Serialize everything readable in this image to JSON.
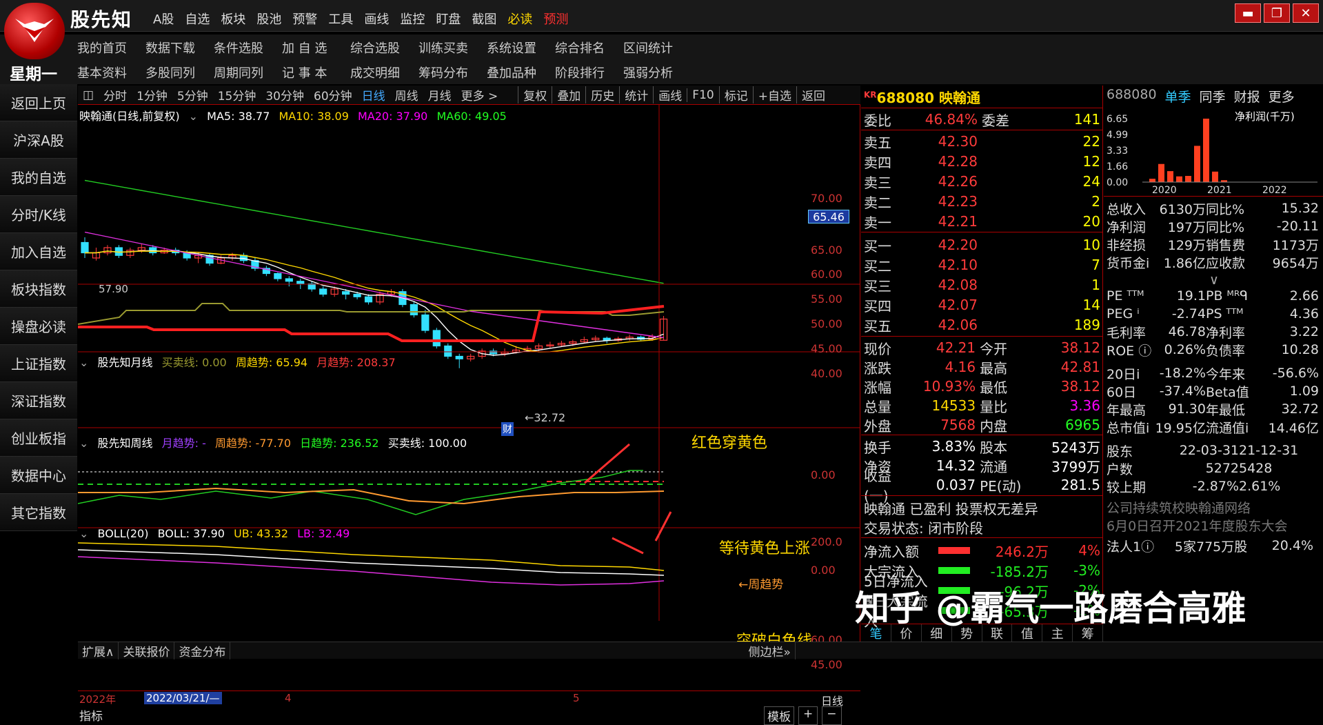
{
  "app": {
    "name": "股先知",
    "menu": [
      "A股",
      "自选",
      "板块",
      "股池",
      "预警",
      "工具",
      "画线",
      "监控",
      "盯盘",
      "截图",
      "必读",
      "预测"
    ],
    "window_buttons": [
      "▬",
      "❐",
      "✕"
    ]
  },
  "row2": [
    "我的首页",
    "数据下载",
    "条件选股",
    "加 自 选",
    "综合选股",
    "训练买卖",
    "系统设置",
    "综合排名",
    "区间统计"
  ],
  "row3": [
    "基本资料",
    "多股同列",
    "周期同列",
    "记 事 本",
    "成交明细",
    "筹码分布",
    "叠加品种",
    "阶段排行",
    "强弱分析"
  ],
  "weekday": "星期一",
  "sidebar": [
    "返回上页",
    "沪深A股",
    "我的自选",
    "分时/K线",
    "加入自选",
    "板块指数",
    "操盘必读",
    "上证指数",
    "深证指数",
    "创业板指",
    "数据中心",
    "其它指数"
  ],
  "toolbar": {
    "periods": [
      "分时",
      "1分钟",
      "5分钟",
      "15分钟",
      "30分钟",
      "60分钟",
      "日线",
      "周线",
      "月线",
      "更多 >"
    ],
    "buttons": [
      "复权",
      "叠加",
      "历史",
      "统计",
      "画线",
      "F10",
      "标记",
      "+自选",
      "返回"
    ]
  },
  "chart1": {
    "title": "映翰通(日线,前复权)",
    "ma5": "MA5: 38.77",
    "ma10": "MA10: 38.09",
    "ma20": "MA20: 37.90",
    "ma60": "MA60: 49.05",
    "price_ticks": [
      "70.00",
      "65.00",
      "60.00",
      "55.00",
      "50.00",
      "45.00",
      "40.00"
    ],
    "cursor_price": "65.46",
    "high_label": "57.90",
    "low_label": "←32.72",
    "cai_marker": "财"
  },
  "chart2": {
    "title": "股先知月线",
    "l1": "买卖线: 0.00",
    "l2": "周趋势: 65.94",
    "l3": "月趋势: 208.37",
    "tick": "0.00",
    "annot": "红色穿黄色"
  },
  "chart3": {
    "title": "股先知周线",
    "l1": "月趋势: -",
    "l2": "周趋势: -77.70",
    "l3": "日趋势: 236.52",
    "l4": "买卖线: 100.00",
    "ticks": [
      "200.0",
      "0.00"
    ],
    "annot": "等待黄色上涨",
    "zq": "←周趋势"
  },
  "chart4": {
    "title": "BOLL(20)",
    "l1": "BOLL: 37.90",
    "l2": "UB: 43.32",
    "l3": "LB: 32.49",
    "ticks": [
      "60.00",
      "45.00"
    ],
    "annot": "突破白色线"
  },
  "xaxis": {
    "year": "2022年",
    "date": "2022/03/21/—",
    "m4": "4",
    "m5": "5",
    "period": "日线"
  },
  "bottom_left": {
    "indicator": "指标",
    "items": [
      "扩展∧",
      "关联报价",
      "资金分布"
    ],
    "mb": "模板",
    "plus": "+",
    "minus": "−",
    "sidebar": "侧边栏»"
  },
  "quote": {
    "code": "688080",
    "name": "映翰通",
    "kr": "KR",
    "weibi": {
      "l": "委比",
      "v": "46.84%",
      "l2": "委差",
      "n": "141"
    },
    "sells": [
      [
        "卖五",
        "42.30",
        "22"
      ],
      [
        "卖四",
        "42.28",
        "12"
      ],
      [
        "卖三",
        "42.26",
        "24"
      ],
      [
        "卖二",
        "42.23",
        "2"
      ],
      [
        "卖一",
        "42.21",
        "20"
      ]
    ],
    "buys": [
      [
        "买一",
        "42.20",
        "10"
      ],
      [
        "买二",
        "42.10",
        "7"
      ],
      [
        "买三",
        "42.08",
        "1"
      ],
      [
        "买四",
        "42.07",
        "14"
      ],
      [
        "买五",
        "42.06",
        "189"
      ]
    ],
    "stats": [
      [
        "现价",
        "42.21",
        "今开",
        "38.12"
      ],
      [
        "涨跌",
        "4.16",
        "最高",
        "42.81"
      ],
      [
        "涨幅",
        "10.93%",
        "最低",
        "38.12"
      ],
      [
        "总量",
        "14533",
        "量比",
        "3.36"
      ],
      [
        "外盘",
        "7568",
        "内盘",
        "6965"
      ]
    ],
    "stats2": [
      [
        "换手",
        "3.83%",
        "股本",
        "5243万"
      ],
      [
        "净资",
        "14.32",
        "流通",
        "3799万"
      ],
      [
        "收益(一)",
        "0.037",
        "PE(动)",
        "281.5"
      ]
    ],
    "profit": "映翰通 已盈利 投票权无差异",
    "status": "交易状态: 闭市阶段",
    "flows": [
      [
        "净流入额",
        "246.2万",
        "4%"
      ],
      [
        "大宗流入",
        "-185.2万",
        "-3%"
      ],
      [
        "5日净流入额",
        "-96.2万",
        "-2%"
      ],
      [
        "5日大宗流入",
        "-65.3万",
        "-1%"
      ]
    ],
    "tabs": [
      "笔",
      "价",
      "细",
      "势",
      "联",
      "值",
      "主",
      "筹"
    ]
  },
  "fin": {
    "code": "688080",
    "tabs": [
      "单季",
      "同季",
      "财报",
      "更多"
    ],
    "chart_title": "净利润(千万)",
    "yticks": [
      "6.65",
      "4.99",
      "3.33",
      "1.66",
      "0.00"
    ],
    "xticks": [
      "2020",
      "2021",
      "2022"
    ],
    "rows": [
      [
        "总收入",
        "6130万",
        "同比%",
        "15.32"
      ],
      [
        "净利润",
        "197万",
        "同比%",
        "-20.11"
      ],
      [
        "非经损",
        "129万",
        "销售费",
        "1173万"
      ],
      [
        "货币金i",
        "1.86亿",
        "应收款",
        "9654万"
      ]
    ],
    "rows2": [
      [
        "PE ᵀᵀᴹ",
        "19.1",
        "PB ᴹᴿᑫ",
        "2.66"
      ],
      [
        "PEG ⁱ",
        "-2.74",
        "PS ᵀᵀᴹ",
        "4.36"
      ],
      [
        "毛利率",
        "46.78",
        "净利率",
        "3.22"
      ],
      [
        "ROE ⓘ",
        "0.26%",
        "负债率",
        "10.28"
      ]
    ],
    "rows3": [
      [
        "20日i",
        "-18.2%",
        "今年来",
        "-56.6%"
      ],
      [
        "60日",
        "-37.4%",
        "Beta值",
        "1.09"
      ],
      [
        "年最高",
        "91.30",
        "年最低",
        "32.72"
      ],
      [
        "总市值i",
        "19.95亿",
        "流通值i",
        "14.46亿"
      ]
    ],
    "rows4": [
      [
        "股东",
        "22-03-31",
        "21-12-31"
      ],
      [
        "户数",
        "5272",
        "5428"
      ],
      [
        "较上期",
        "-2.87%",
        "2.61%"
      ]
    ],
    "news": [
      "公司持续筑校映翰通网络",
      "6月0日召开2021年度股东大会"
    ],
    "last": [
      "法人1ⓘ",
      "5家",
      "775万股",
      "20.4%"
    ]
  },
  "chart_data": {
    "type": "bar",
    "title": "净利润(千万)",
    "categories": [
      "2020Q1",
      "2020Q2",
      "2020Q3",
      "2020Q4",
      "2021Q1",
      "2021Q2",
      "2021Q3",
      "2021Q4",
      "2022Q1"
    ],
    "values": [
      0.35,
      1.9,
      1.15,
      0.6,
      0.65,
      3.8,
      6.65,
      1.1,
      0.2
    ],
    "ylim": [
      0,
      6.65
    ]
  },
  "watermark": "知乎 @霸气一路磨合高雅",
  "colors": {
    "up": "#ff3b3b",
    "down": "#33e0ff",
    "ma5": "#ffffff",
    "ma10": "#ffd800",
    "ma20": "#e030e0",
    "ma60": "#22cc22"
  }
}
